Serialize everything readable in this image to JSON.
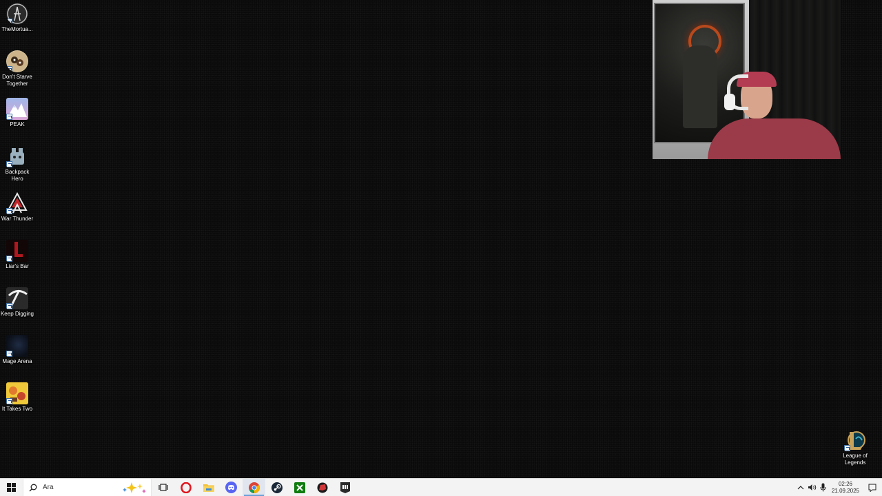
{
  "desktop": {
    "icons": [
      {
        "label": "TheMortua...",
        "icon": "the-mortuary-assistant-icon"
      },
      {
        "label": "Don't Starve Together",
        "icon": "dont-starve-together-icon"
      },
      {
        "label": "PEAK",
        "icon": "peak-icon"
      },
      {
        "label": "Backpack Hero",
        "icon": "backpack-hero-icon"
      },
      {
        "label": "War Thunder",
        "icon": "war-thunder-icon"
      },
      {
        "label": "Liar's Bar",
        "icon": "liars-bar-icon"
      },
      {
        "label": "Keep Digging",
        "icon": "keep-digging-icon"
      },
      {
        "label": "Mage Arena",
        "icon": "mage-arena-icon"
      },
      {
        "label": "It Takes Two",
        "icon": "it-takes-two-icon"
      },
      {
        "label": "League of Legends",
        "icon": "league-of-legends-icon"
      }
    ]
  },
  "taskbar": {
    "search": {
      "placeholder": "Ara"
    },
    "apps": [
      {
        "name": "opera",
        "icon": "opera-icon"
      },
      {
        "name": "file-explorer",
        "icon": "folder-icon"
      },
      {
        "name": "discord",
        "icon": "discord-icon"
      },
      {
        "name": "chrome",
        "icon": "chrome-icon",
        "active": true
      },
      {
        "name": "steam",
        "icon": "steam-icon"
      },
      {
        "name": "xbox",
        "icon": "xbox-icon"
      },
      {
        "name": "riot-client",
        "icon": "riot-icon"
      },
      {
        "name": "epic-games",
        "icon": "epic-games-icon"
      }
    ],
    "clock": {
      "time": "02:26",
      "date": "21.09.2025"
    }
  },
  "colors": {
    "taskbar_bg": "#f3f3f3",
    "desktop_bg": "#0a0a0a",
    "active_indicator": "#6aa0d8"
  }
}
